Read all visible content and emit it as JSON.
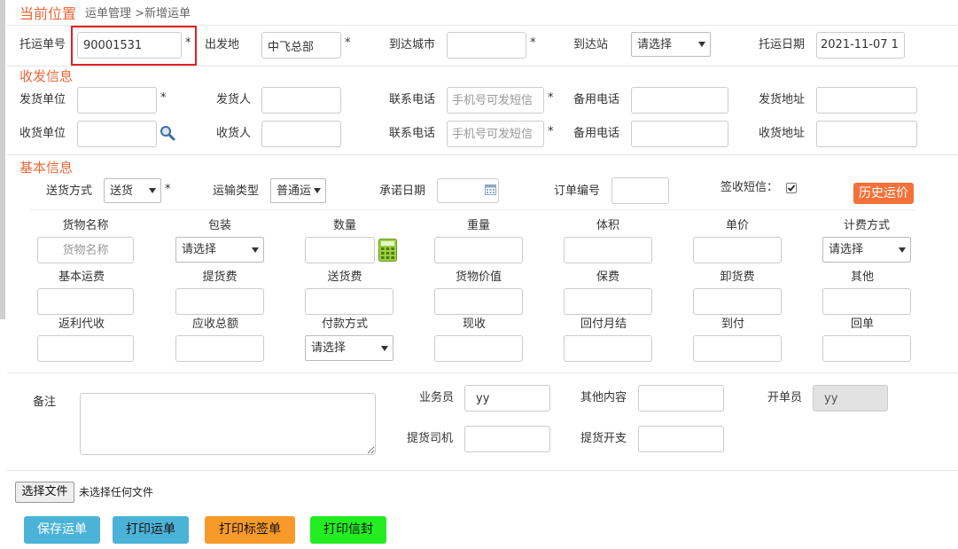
{
  "breadcrumb": {
    "title": "当前位置",
    "path": "运单管理 >新增运单"
  },
  "top": {
    "waybill_label": "托运单号",
    "waybill_value": "90001531",
    "origin_label": "出发地",
    "origin_value": "中飞总部",
    "dest_city_label": "到达城市",
    "dest_city_value": "",
    "dest_station_label": "到达站",
    "dest_station_value": "请选择",
    "date_label": "托运日期",
    "date_value": "2021-11-07 1"
  },
  "sender_receiver": {
    "section_title": "收发信息",
    "sender_unit_label": "发货单位",
    "sender_label": "发货人",
    "phone_label": "联系电话",
    "phone_placeholder": "手机号可发短信",
    "alt_phone_label": "备用电话",
    "sender_address_label": "发货地址",
    "receiver_unit_label": "收货单位",
    "receiver_label": "收货人",
    "receiver_phone_label": "联系电话",
    "receiver_phone_placeholder": "手机号可发短信",
    "receiver_alt_phone_label": "备用电话",
    "receiver_address_label": "收货地址"
  },
  "basic": {
    "section_title": "基本信息",
    "delivery_label": "送货方式",
    "delivery_value": "送货",
    "transport_label": "运输类型",
    "transport_value": "普通运",
    "promise_date_label": "承诺日期",
    "order_no_label": "订单编号",
    "sms_label": "签收短信：",
    "history_button": "历史运价",
    "grid_row1_labels": [
      "货物名称",
      "包装",
      "数量",
      "重量",
      "体积",
      "单价",
      "计费方式"
    ],
    "goods_placeholder": "货物名称",
    "package_value": "请选择",
    "billing_value": "请选择",
    "grid_row2_labels": [
      "基本运费",
      "提货费",
      "送货费",
      "货物价值",
      "保费",
      "卸货费",
      "其他"
    ],
    "grid_row3_labels": [
      "返利代收",
      "应收总额",
      "付款方式",
      "现收",
      "回付月结",
      "到付",
      "回单"
    ],
    "payment_value": "请选择"
  },
  "remarks": {
    "remark_label": "备注",
    "salesman_label": "业务员",
    "salesman_value": "yy",
    "other_label": "其他内容",
    "issuer_label": "开单员",
    "issuer_value": "yy",
    "driver_label": "提货司机",
    "pickup_expense_label": "提货开支"
  },
  "file": {
    "choose_button": "选择文件",
    "status": "未选择任何文件"
  },
  "actions": {
    "save": "保存运单",
    "print": "打印运单",
    "print_label": "打印标签单",
    "print_envelope": "打印信封"
  },
  "colors": {
    "accent": "#e8673a",
    "highlight_border": "#e02020",
    "save_button": "#4bb3d8",
    "print_button": "#4bb3d8",
    "label_button": "#f79a2a",
    "envelope_button": "#22ee22",
    "history_button": "#f5713a"
  }
}
